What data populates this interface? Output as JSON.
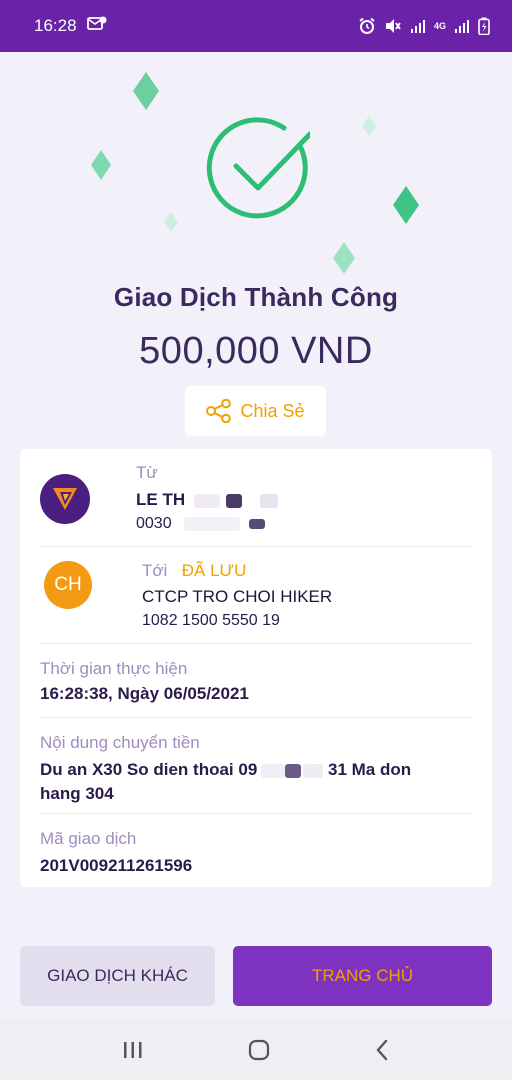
{
  "status_bar": {
    "time": "16:28",
    "network": "4G"
  },
  "colors": {
    "brand_purple": "#6A23A8",
    "success_green": "#2DBE75",
    "accent_orange": "#F0A000"
  },
  "result": {
    "title": "Giao Dịch Thành Công",
    "amount": "500,000 VND",
    "share_label": "Chia Sẻ"
  },
  "from": {
    "label": "Từ",
    "name": "LE TH",
    "account": "0030"
  },
  "to": {
    "label": "Tới",
    "saved_badge": "ĐÃ LƯU",
    "avatar_initials": "CH",
    "name": "CTCP TRO CHOI HIKER",
    "account": "1082 1500 5550 19"
  },
  "time": {
    "label": "Thời gian thực hiện",
    "value": "16:28:38, Ngày 06/05/2021"
  },
  "content": {
    "label": "Nội dung chuyển tiền",
    "line1_prefix": "Du an X30 So dien thoai 09",
    "line1_suffix": "31 Ma don",
    "line2": "hang 304"
  },
  "transaction": {
    "label": "Mã giao dịch",
    "value": "201V009211261596"
  },
  "buttons": {
    "other": "GIAO DỊCH KHÁC",
    "home": "TRANG CHỦ"
  },
  "nav": {
    "icons": [
      "recent-apps-icon",
      "home-icon",
      "back-icon"
    ]
  }
}
